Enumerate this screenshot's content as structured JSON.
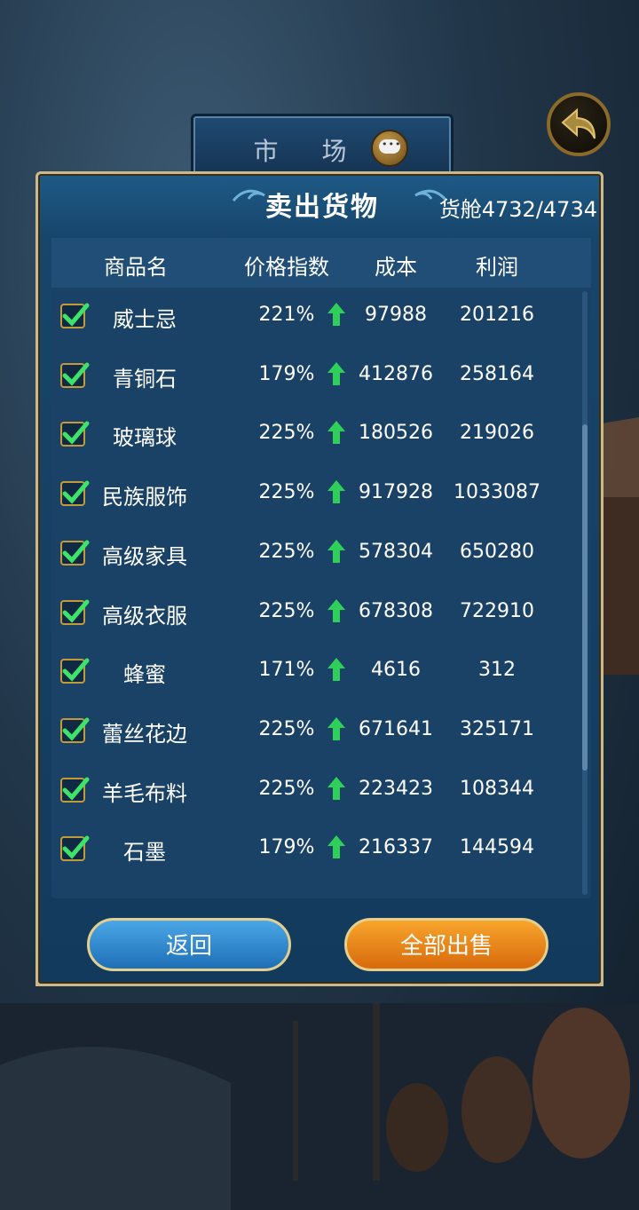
{
  "header": {
    "market_label": "市 场",
    "chat_icon": "chat-bubble-icon",
    "back_icon": "return-arrow-icon"
  },
  "panel": {
    "title": "卖出货物",
    "cargo": "货舱4732/4734"
  },
  "table": {
    "columns": [
      "商品名",
      "价格指数",
      "成本",
      "利润"
    ],
    "rows": [
      {
        "checked": true,
        "name": "威士忌",
        "price_index": "221%",
        "trend": "up",
        "cost": "97988",
        "profit": "201216"
      },
      {
        "checked": true,
        "name": "青铜石",
        "price_index": "179%",
        "trend": "up",
        "cost": "412876",
        "profit": "258164"
      },
      {
        "checked": true,
        "name": "玻璃球",
        "price_index": "225%",
        "trend": "up",
        "cost": "180526",
        "profit": "219026"
      },
      {
        "checked": true,
        "name": "民族服饰",
        "price_index": "225%",
        "trend": "up",
        "cost": "917928",
        "profit": "1033087"
      },
      {
        "checked": true,
        "name": "高级家具",
        "price_index": "225%",
        "trend": "up",
        "cost": "578304",
        "profit": "650280"
      },
      {
        "checked": true,
        "name": "高级衣服",
        "price_index": "225%",
        "trend": "up",
        "cost": "678308",
        "profit": "722910"
      },
      {
        "checked": true,
        "name": "蜂蜜",
        "price_index": "171%",
        "trend": "up",
        "cost": "4616",
        "profit": "312"
      },
      {
        "checked": true,
        "name": "蕾丝花边",
        "price_index": "225%",
        "trend": "up",
        "cost": "671641",
        "profit": "325171"
      },
      {
        "checked": true,
        "name": "羊毛布料",
        "price_index": "225%",
        "trend": "up",
        "cost": "223423",
        "profit": "108344"
      },
      {
        "checked": true,
        "name": "石墨",
        "price_index": "179%",
        "trend": "up",
        "cost": "216337",
        "profit": "144594"
      }
    ]
  },
  "buttons": {
    "back": "返回",
    "sell_all": "全部出售"
  },
  "colors": {
    "trend_up": "#2fd05a",
    "check": "#3ee46a",
    "sell_button": "#e8830f",
    "back_button": "#2f8fd6"
  }
}
